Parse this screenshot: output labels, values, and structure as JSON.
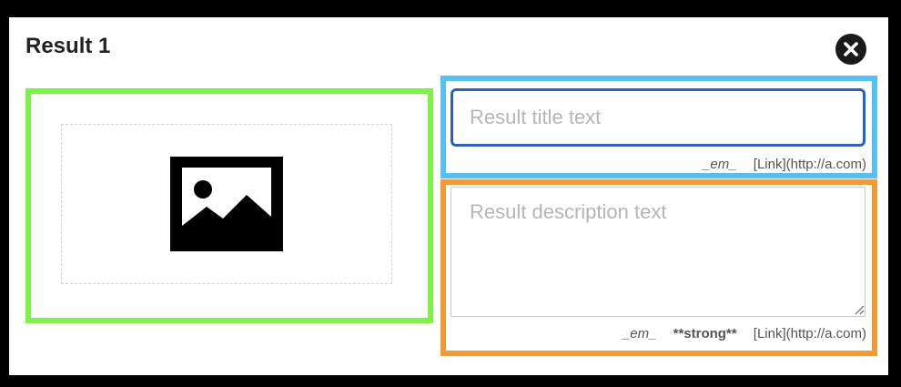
{
  "dialog": {
    "title": "Result 1",
    "close_icon": "close-icon"
  },
  "image_field": {
    "icon": "image-placeholder-icon"
  },
  "title_field": {
    "placeholder": "Result title text",
    "value": "",
    "hints": {
      "em": "_em_",
      "link": "[Link](http://a.com)"
    }
  },
  "description_field": {
    "placeholder": "Result description text",
    "value": "",
    "hints": {
      "em": "_em_",
      "strong": "**strong**",
      "link": "[Link](http://a.com)"
    }
  },
  "highlights": {
    "green": "#7ff24a",
    "blue": "#56c1f1",
    "orange": "#f19a38"
  },
  "colors": {
    "focus_border": "#2a63b8",
    "close_button": "#1a1a1a"
  }
}
